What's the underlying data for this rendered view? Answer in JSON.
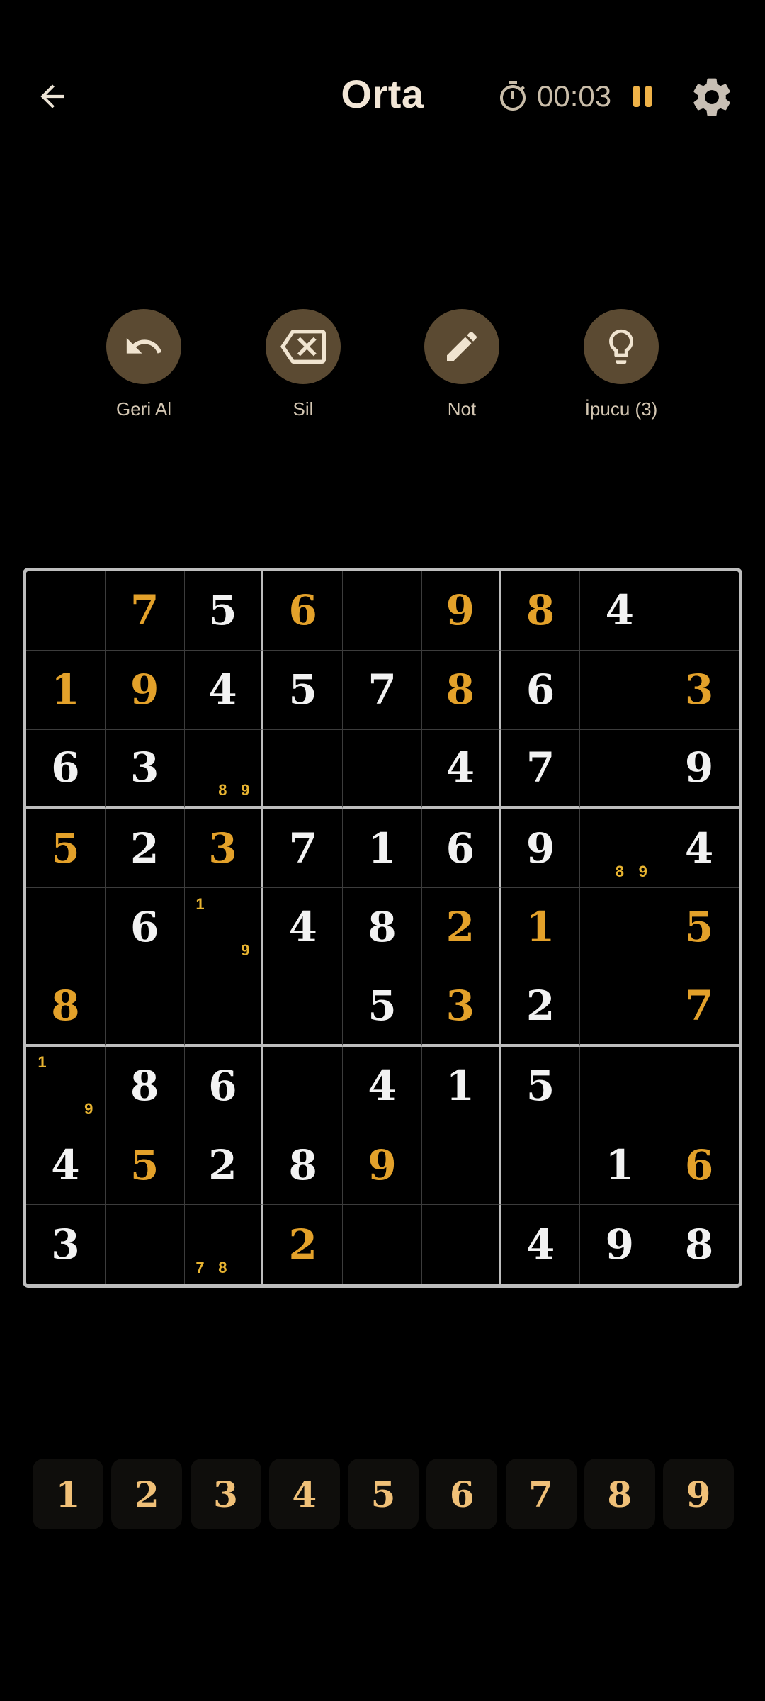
{
  "header": {
    "title": "Orta",
    "timer": "00:03",
    "icons": {
      "back": "arrow-left-icon",
      "timer": "stopwatch-icon",
      "pause": "pause-icon",
      "settings": "gear-icon"
    }
  },
  "actions": [
    {
      "name": "undo",
      "label": "Geri Al",
      "icon": "undo-icon"
    },
    {
      "name": "erase",
      "label": "Sil",
      "icon": "backspace-icon"
    },
    {
      "name": "notes",
      "label": "Not",
      "icon": "pencil-icon"
    },
    {
      "name": "hint",
      "label": "İpucu (3)",
      "icon": "lightbulb-icon"
    }
  ],
  "colors": {
    "background": "#000000",
    "given_digit": "#f2f2f2",
    "entered_digit": "#e3a12a",
    "note_digit": "#e8b431",
    "action_circle": "#5b4a32",
    "pause_accent": "#efb248",
    "numpad_digit": "#f0c078"
  },
  "board": {
    "cells": [
      [
        {
          "v": ""
        },
        {
          "v": "7",
          "t": "e"
        },
        {
          "v": "5",
          "t": "g"
        },
        {
          "v": "6",
          "t": "e"
        },
        {
          "v": ""
        },
        {
          "v": "9",
          "t": "e"
        },
        {
          "v": "8",
          "t": "e"
        },
        {
          "v": "4",
          "t": "g"
        },
        {
          "v": ""
        }
      ],
      [
        {
          "v": "1",
          "t": "e"
        },
        {
          "v": "9",
          "t": "e"
        },
        {
          "v": "4",
          "t": "g"
        },
        {
          "v": "5",
          "t": "g"
        },
        {
          "v": "7",
          "t": "g"
        },
        {
          "v": "8",
          "t": "e"
        },
        {
          "v": "6",
          "t": "g"
        },
        {
          "v": ""
        },
        {
          "v": "3",
          "t": "e"
        }
      ],
      [
        {
          "v": "6",
          "t": "g"
        },
        {
          "v": "3",
          "t": "g"
        },
        {
          "v": "",
          "n": [
            "8",
            "9"
          ]
        },
        {
          "v": ""
        },
        {
          "v": ""
        },
        {
          "v": "4",
          "t": "g"
        },
        {
          "v": "7",
          "t": "g"
        },
        {
          "v": ""
        },
        {
          "v": "9",
          "t": "g"
        }
      ],
      [
        {
          "v": "5",
          "t": "e"
        },
        {
          "v": "2",
          "t": "g"
        },
        {
          "v": "3",
          "t": "e"
        },
        {
          "v": "7",
          "t": "g"
        },
        {
          "v": "1",
          "t": "g"
        },
        {
          "v": "6",
          "t": "g"
        },
        {
          "v": "9",
          "t": "g"
        },
        {
          "v": "",
          "n": [
            "8",
            "9"
          ]
        },
        {
          "v": "4",
          "t": "g"
        }
      ],
      [
        {
          "v": ""
        },
        {
          "v": "6",
          "t": "g"
        },
        {
          "v": "",
          "n": [
            "1",
            "9"
          ]
        },
        {
          "v": "4",
          "t": "g"
        },
        {
          "v": "8",
          "t": "g"
        },
        {
          "v": "2",
          "t": "e"
        },
        {
          "v": "1",
          "t": "e"
        },
        {
          "v": ""
        },
        {
          "v": "5",
          "t": "e"
        }
      ],
      [
        {
          "v": "8",
          "t": "e"
        },
        {
          "v": ""
        },
        {
          "v": ""
        },
        {
          "v": ""
        },
        {
          "v": "5",
          "t": "g"
        },
        {
          "v": "3",
          "t": "e"
        },
        {
          "v": "2",
          "t": "g"
        },
        {
          "v": ""
        },
        {
          "v": "7",
          "t": "e"
        }
      ],
      [
        {
          "v": "",
          "n": [
            "1",
            "9"
          ]
        },
        {
          "v": "8",
          "t": "g"
        },
        {
          "v": "6",
          "t": "g"
        },
        {
          "v": ""
        },
        {
          "v": "4",
          "t": "g"
        },
        {
          "v": "1",
          "t": "g"
        },
        {
          "v": "5",
          "t": "g"
        },
        {
          "v": ""
        },
        {
          "v": ""
        }
      ],
      [
        {
          "v": "4",
          "t": "g"
        },
        {
          "v": "5",
          "t": "e"
        },
        {
          "v": "2",
          "t": "g"
        },
        {
          "v": "8",
          "t": "g"
        },
        {
          "v": "9",
          "t": "e"
        },
        {
          "v": ""
        },
        {
          "v": ""
        },
        {
          "v": "1",
          "t": "g"
        },
        {
          "v": "6",
          "t": "e"
        }
      ],
      [
        {
          "v": "3",
          "t": "g"
        },
        {
          "v": ""
        },
        {
          "v": "",
          "n": [
            "7",
            "8"
          ]
        },
        {
          "v": "2",
          "t": "e"
        },
        {
          "v": ""
        },
        {
          "v": ""
        },
        {
          "v": "4",
          "t": "g"
        },
        {
          "v": "9",
          "t": "g"
        },
        {
          "v": "8",
          "t": "g"
        }
      ]
    ]
  },
  "numpad": [
    "1",
    "2",
    "3",
    "4",
    "5",
    "6",
    "7",
    "8",
    "9"
  ]
}
